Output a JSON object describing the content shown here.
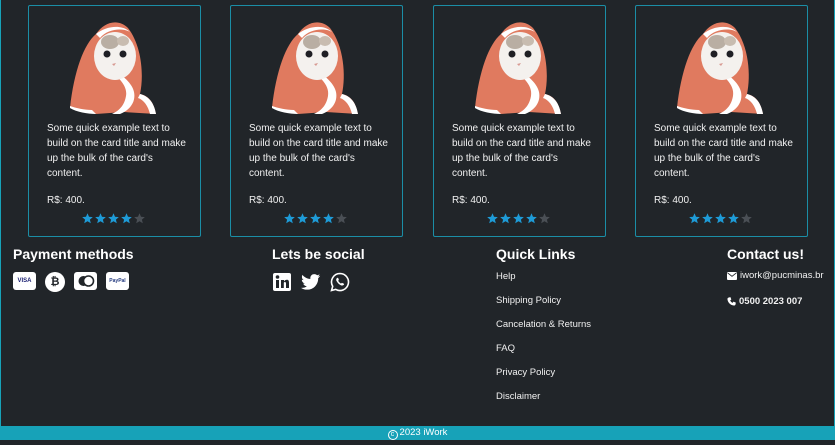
{
  "cards": [
    {
      "text": "Some quick example text to build on the card title and make up the bulk of the card's content.",
      "price": "R$: 400.",
      "rating": 4,
      "max_rating": 5
    },
    {
      "text": "Some quick example text to build on the card title and make up the bulk of the card's content.",
      "price": "R$: 400.",
      "rating": 4,
      "max_rating": 5
    },
    {
      "text": "Some quick example text to build on the card title and make up the bulk of the card's content.",
      "price": "R$: 400.",
      "rating": 4,
      "max_rating": 5
    },
    {
      "text": "Some quick example text to build on the card title and make up the bulk of the card's content.",
      "price": "R$: 400.",
      "rating": 4,
      "max_rating": 5
    }
  ],
  "footer": {
    "payment": {
      "title": "Payment methods",
      "icons": [
        "visa-icon",
        "bitcoin-icon",
        "mastercard-icon",
        "paypal-icon"
      ],
      "visa_label": "VISA",
      "bitcoin_label": "₿",
      "paypal_label": "PayPal"
    },
    "social": {
      "title": "Lets be social",
      "icons": [
        "linkedin-icon",
        "twitter-icon",
        "whatsapp-icon"
      ]
    },
    "links": {
      "title": "Quick Links",
      "items": [
        "Help",
        "Shipping Policy",
        "Cancelation & Returns",
        "FAQ",
        "Privacy Policy",
        "Disclaimer"
      ]
    },
    "contact": {
      "title": "Contact us!",
      "email": "iwork@pucminas.br",
      "phone": "0500 2023 007"
    },
    "copyright": "2023 iWork"
  },
  "colors": {
    "background": "#212529",
    "accent": "#17a2b8",
    "star_filled": "#1e9bd7",
    "star_empty": "#4a4f55"
  }
}
